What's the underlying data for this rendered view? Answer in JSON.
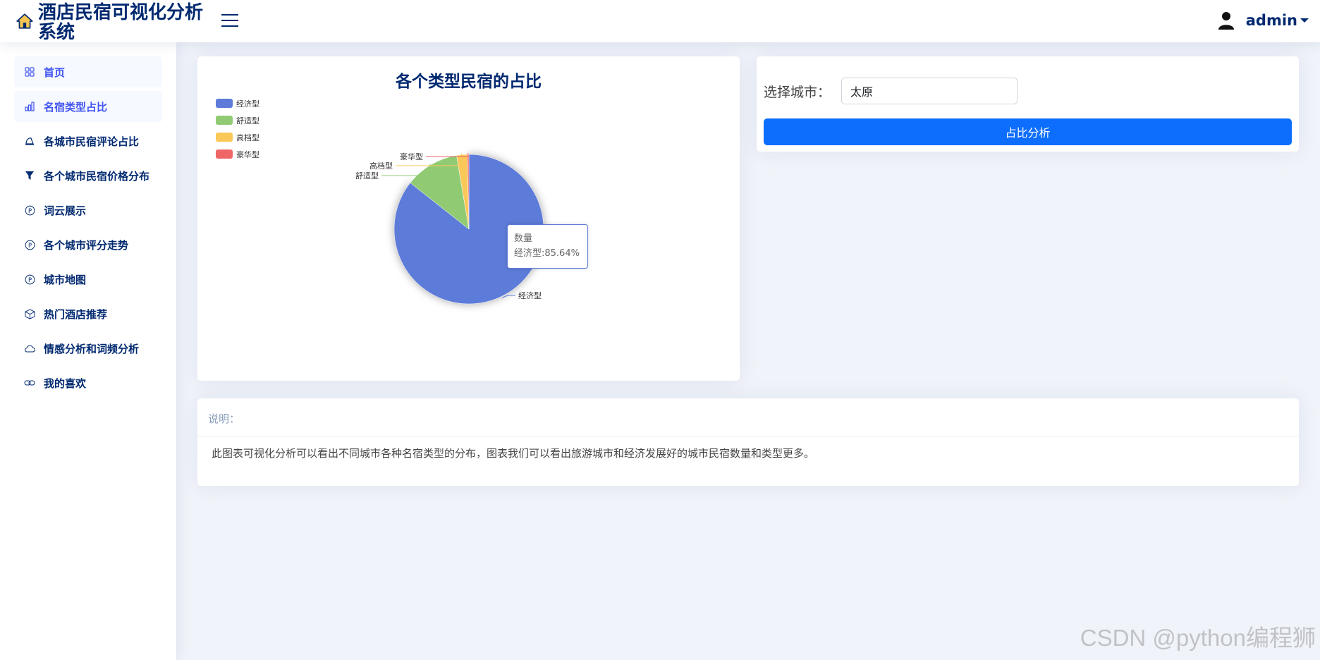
{
  "app": {
    "title": "酒店民宿可视化分析系统",
    "user": "admin"
  },
  "sidebar": {
    "items": [
      {
        "label": "首页",
        "icon": "grid-icon"
      },
      {
        "label": "名宿类型占比",
        "icon": "bar-chart-icon"
      },
      {
        "label": "各城市民宿评论占比",
        "icon": "hat-icon"
      },
      {
        "label": "各个城市民宿价格分布",
        "icon": "filter-icon"
      },
      {
        "label": "词云展示",
        "icon": "p-circle-icon"
      },
      {
        "label": "各个城市评分走势",
        "icon": "p-circle-icon"
      },
      {
        "label": "城市地图",
        "icon": "p-circle-icon"
      },
      {
        "label": "热门酒店推荐",
        "icon": "box-icon"
      },
      {
        "label": "情感分析和词频分析",
        "icon": "cloud-icon"
      },
      {
        "label": "我的喜欢",
        "icon": "link-icon"
      }
    ],
    "active_index": 1
  },
  "chart_data": {
    "type": "pie",
    "title": "各个类型民宿的占比",
    "series_name": "数量",
    "categories": [
      "经济型",
      "舒适型",
      "高档型",
      "豪华型"
    ],
    "values": [
      85.64,
      11.72,
      2.3,
      0.34
    ],
    "colors": [
      "#5d7bd8",
      "#90cb74",
      "#fac858",
      "#ee6666"
    ],
    "legend_position": "top-left",
    "tooltip": {
      "title": "数量",
      "text": "经济型:85.64%"
    }
  },
  "form": {
    "city_label": "选择城市：",
    "city_value": "太原",
    "submit_label": "占比分析"
  },
  "description": {
    "header": "说明：",
    "text": "此图表可视化分析可以看出不同城市各种名宿类型的分布，图表我们可以看出旅游城市和经济发展好的城市民宿数量和类型更多。"
  },
  "watermark": "CSDN @python编程狮"
}
